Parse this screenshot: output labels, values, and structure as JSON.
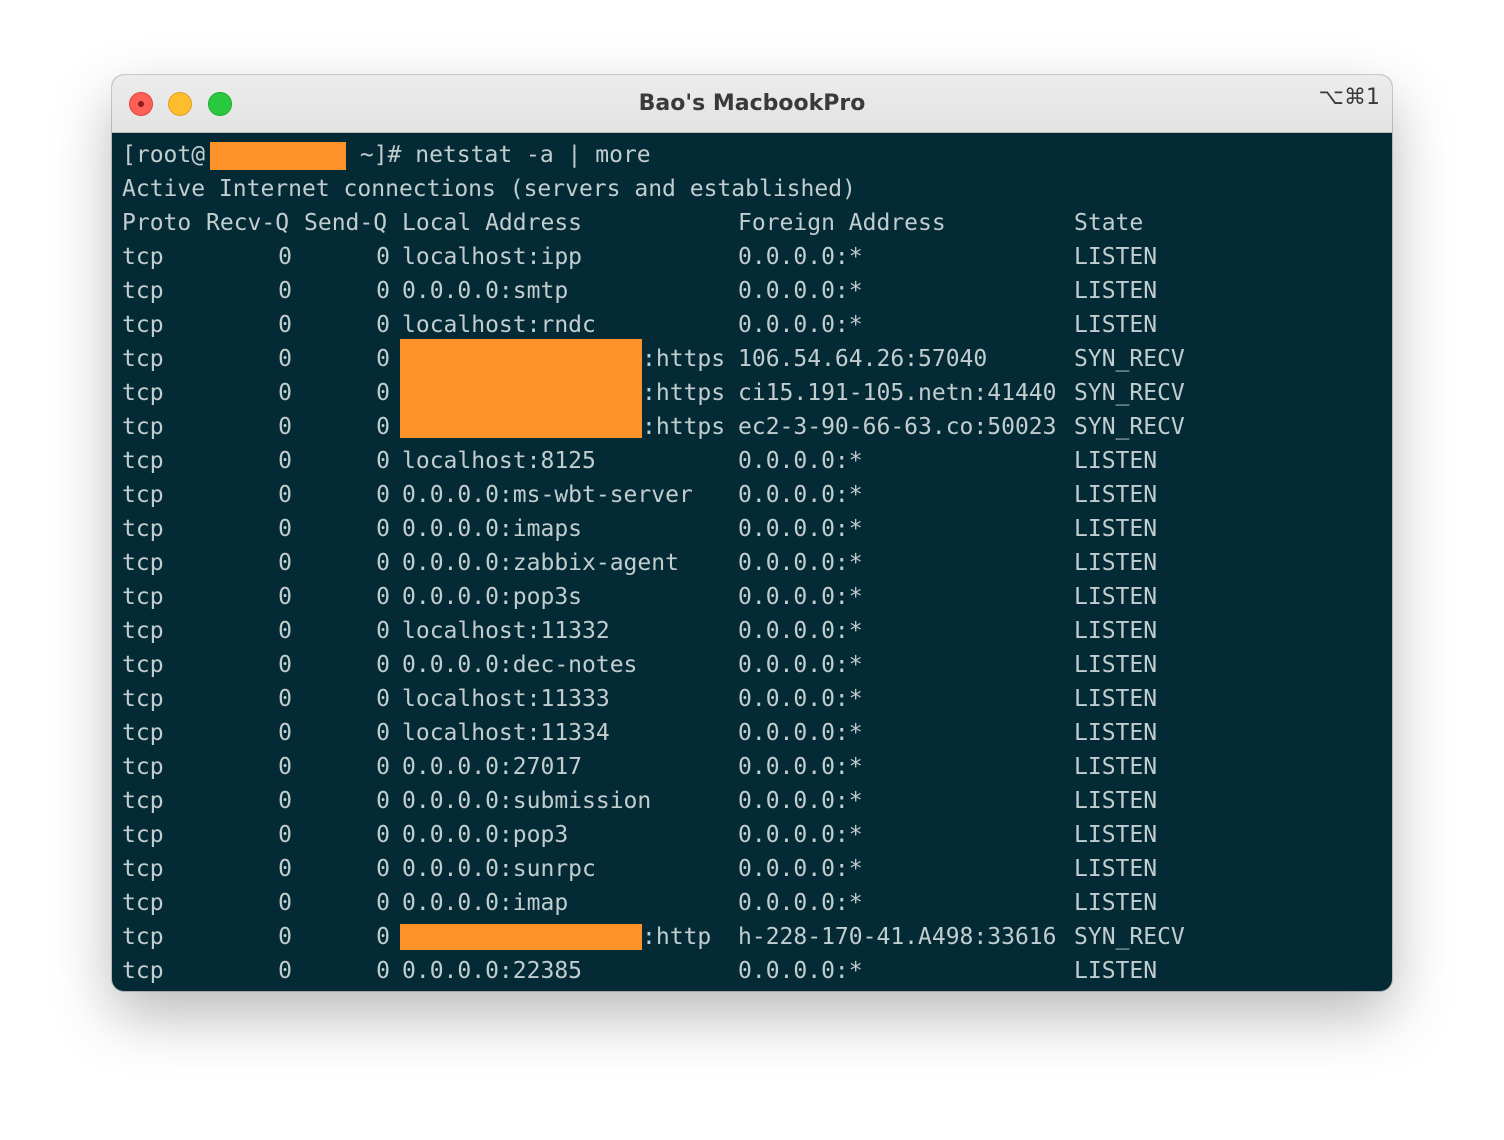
{
  "window": {
    "title": "Bao's MacbookPro",
    "shortcut": "⌥⌘1"
  },
  "terminal": {
    "prompt_prefix": "[root@",
    "prompt_suffix": " ~]# netstat -a | more",
    "info_line": "Active Internet connections (servers and established)",
    "headers": {
      "proto": "Proto",
      "recvq": "Recv-Q",
      "sendq": "Send-Q",
      "local": "Local Address",
      "foreign": "Foreign Address",
      "state": "State"
    },
    "rows": [
      {
        "proto": "tcp",
        "recvq": "0",
        "sendq": "0",
        "local": "localhost:ipp",
        "foreign": "0.0.0.0:*",
        "state": "LISTEN"
      },
      {
        "proto": "tcp",
        "recvq": "0",
        "sendq": "0",
        "local": "0.0.0.0:smtp",
        "foreign": "0.0.0.0:*",
        "state": "LISTEN"
      },
      {
        "proto": "tcp",
        "recvq": "0",
        "sendq": "0",
        "local": "localhost:rndc",
        "foreign": "0.0.0.0:*",
        "state": "LISTEN"
      },
      {
        "proto": "tcp",
        "recvq": "0",
        "sendq": "0",
        "local": ":https",
        "foreign": "106.54.64.26:57040",
        "state": "SYN_RECV",
        "redacted": true
      },
      {
        "proto": "tcp",
        "recvq": "0",
        "sendq": "0",
        "local": ":https",
        "foreign": "ci15.191-105.netn:41440",
        "state": "SYN_RECV",
        "redacted": true
      },
      {
        "proto": "tcp",
        "recvq": "0",
        "sendq": "0",
        "local": ":https",
        "foreign": "ec2-3-90-66-63.co:50023",
        "state": "SYN_RECV",
        "redacted": true
      },
      {
        "proto": "tcp",
        "recvq": "0",
        "sendq": "0",
        "local": "localhost:8125",
        "foreign": "0.0.0.0:*",
        "state": "LISTEN"
      },
      {
        "proto": "tcp",
        "recvq": "0",
        "sendq": "0",
        "local": "0.0.0.0:ms-wbt-server",
        "foreign": "0.0.0.0:*",
        "state": "LISTEN"
      },
      {
        "proto": "tcp",
        "recvq": "0",
        "sendq": "0",
        "local": "0.0.0.0:imaps",
        "foreign": "0.0.0.0:*",
        "state": "LISTEN"
      },
      {
        "proto": "tcp",
        "recvq": "0",
        "sendq": "0",
        "local": "0.0.0.0:zabbix-agent",
        "foreign": "0.0.0.0:*",
        "state": "LISTEN"
      },
      {
        "proto": "tcp",
        "recvq": "0",
        "sendq": "0",
        "local": "0.0.0.0:pop3s",
        "foreign": "0.0.0.0:*",
        "state": "LISTEN"
      },
      {
        "proto": "tcp",
        "recvq": "0",
        "sendq": "0",
        "local": "localhost:11332",
        "foreign": "0.0.0.0:*",
        "state": "LISTEN"
      },
      {
        "proto": "tcp",
        "recvq": "0",
        "sendq": "0",
        "local": "0.0.0.0:dec-notes",
        "foreign": "0.0.0.0:*",
        "state": "LISTEN"
      },
      {
        "proto": "tcp",
        "recvq": "0",
        "sendq": "0",
        "local": "localhost:11333",
        "foreign": "0.0.0.0:*",
        "state": "LISTEN"
      },
      {
        "proto": "tcp",
        "recvq": "0",
        "sendq": "0",
        "local": "localhost:11334",
        "foreign": "0.0.0.0:*",
        "state": "LISTEN"
      },
      {
        "proto": "tcp",
        "recvq": "0",
        "sendq": "0",
        "local": "0.0.0.0:27017",
        "foreign": "0.0.0.0:*",
        "state": "LISTEN"
      },
      {
        "proto": "tcp",
        "recvq": "0",
        "sendq": "0",
        "local": "0.0.0.0:submission",
        "foreign": "0.0.0.0:*",
        "state": "LISTEN"
      },
      {
        "proto": "tcp",
        "recvq": "0",
        "sendq": "0",
        "local": "0.0.0.0:pop3",
        "foreign": "0.0.0.0:*",
        "state": "LISTEN"
      },
      {
        "proto": "tcp",
        "recvq": "0",
        "sendq": "0",
        "local": "0.0.0.0:sunrpc",
        "foreign": "0.0.0.0:*",
        "state": "LISTEN"
      },
      {
        "proto": "tcp",
        "recvq": "0",
        "sendq": "0",
        "local": "0.0.0.0:imap",
        "foreign": "0.0.0.0:*",
        "state": "LISTEN"
      },
      {
        "proto": "tcp",
        "recvq": "0",
        "sendq": "0",
        "local": ":http",
        "foreign": "h-228-170-41.A498:33616",
        "state": "SYN_RECV",
        "redacted": true
      },
      {
        "proto": "tcp",
        "recvq": "0",
        "sendq": "0",
        "local": "0.0.0.0:22385",
        "foreign": "0.0.0.0:*",
        "state": "LISTEN"
      }
    ]
  },
  "colors": {
    "background": "#042b35",
    "text": "#c2cdcf",
    "redaction": "#fc9228"
  }
}
